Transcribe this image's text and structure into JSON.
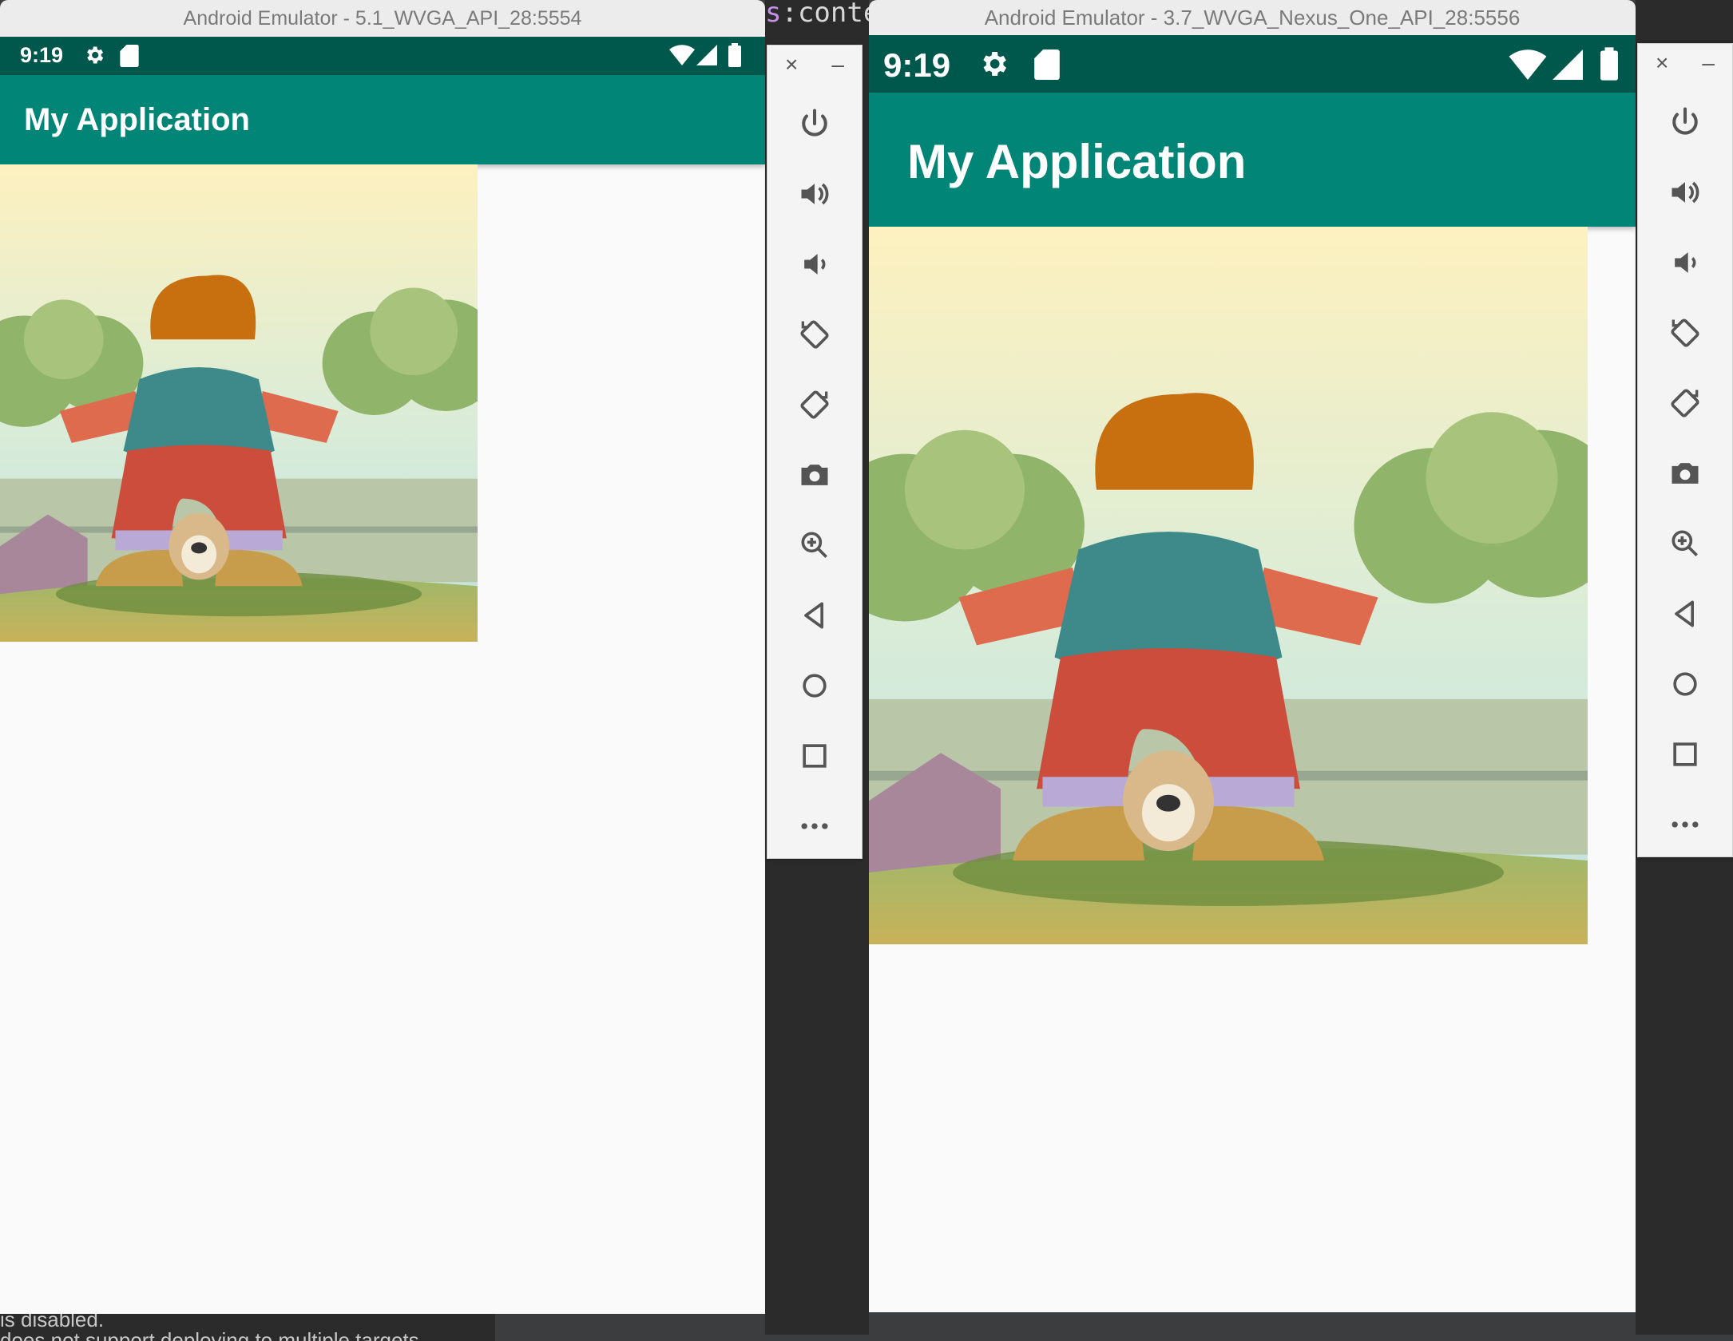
{
  "ide": {
    "code_fragment_prefix": "s",
    "code_fragment_rest": ":conte",
    "bottom_line_1": "is disabled.",
    "bottom_line_2": "does not support deploying to multiple targets"
  },
  "emulators": [
    {
      "window_title": "Android Emulator - 5.1_WVGA_API_28:5554",
      "status_time": "9:19",
      "app_title": "My Application"
    },
    {
      "window_title": "Android Emulator - 3.7_WVGA_Nexus_One_API_28:5556",
      "status_time": "9:19",
      "app_title": "My Application"
    }
  ],
  "toolbar": {
    "close_glyph": "×",
    "minimize_glyph": "–",
    "buttons": [
      "power-icon",
      "volume-up-icon",
      "volume-down-icon",
      "rotate-left-icon",
      "rotate-right-icon",
      "camera-icon",
      "zoom-icon",
      "back-icon",
      "home-icon",
      "overview-icon",
      "more-icon"
    ]
  },
  "colors": {
    "status_bar": "#00574b",
    "app_bar": "#008577",
    "screen_bg": "#fafafa"
  }
}
